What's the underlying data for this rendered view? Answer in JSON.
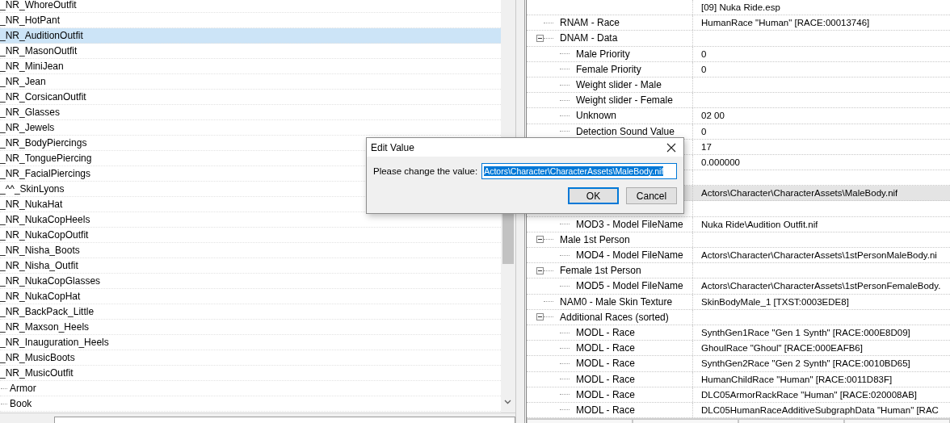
{
  "record_list": {
    "items": [
      {
        "label": "_NR_WhoreOutfit",
        "kind": "record",
        "selected": false
      },
      {
        "label": "_NR_HotPant",
        "kind": "record",
        "selected": false
      },
      {
        "label": "_NR_AuditionOutfit",
        "kind": "record",
        "selected": true
      },
      {
        "label": "_NR_MasonOutfit",
        "kind": "record",
        "selected": false
      },
      {
        "label": "_NR_MiniJean",
        "kind": "record",
        "selected": false
      },
      {
        "label": "_NR_Jean",
        "kind": "record",
        "selected": false
      },
      {
        "label": "_NR_CorsicanOutfit",
        "kind": "record",
        "selected": false
      },
      {
        "label": "_NR_Glasses",
        "kind": "record",
        "selected": false
      },
      {
        "label": "_NR_Jewels",
        "kind": "record",
        "selected": false
      },
      {
        "label": "_NR_BodyPiercings",
        "kind": "record",
        "selected": false
      },
      {
        "label": "_NR_TonguePiercing",
        "kind": "record",
        "selected": false
      },
      {
        "label": "_NR_FacialPiercings",
        "kind": "record",
        "selected": false
      },
      {
        "label": "_^^_SkinLyons",
        "kind": "record",
        "selected": false
      },
      {
        "label": "_NR_NukaHat",
        "kind": "record",
        "selected": false
      },
      {
        "label": "_NR_NukaCopHeels",
        "kind": "record",
        "selected": false
      },
      {
        "label": "_NR_NukaCopOutfit",
        "kind": "record",
        "selected": false
      },
      {
        "label": "_NR_Nisha_Boots",
        "kind": "record",
        "selected": false
      },
      {
        "label": "_NR_Nisha_Outfit",
        "kind": "record",
        "selected": false
      },
      {
        "label": "_NR_NukaCopGlasses",
        "kind": "record",
        "selected": false
      },
      {
        "label": "_NR_NukaCopHat",
        "kind": "record",
        "selected": false
      },
      {
        "label": "_NR_BackPack_Little",
        "kind": "record",
        "selected": false
      },
      {
        "label": "_NR_Maxson_Heels",
        "kind": "record",
        "selected": false
      },
      {
        "label": "_NR_Inauguration_Heels",
        "kind": "record",
        "selected": false
      },
      {
        "label": "_NR_MusicBoots",
        "kind": "record",
        "selected": false
      },
      {
        "label": "_NR_MusicOutfit",
        "kind": "record",
        "selected": false
      },
      {
        "label": "Armor",
        "kind": "group",
        "selected": false
      },
      {
        "label": "Book",
        "kind": "group",
        "selected": false
      }
    ]
  },
  "record_view": {
    "header": "[09] Nuka Ride.esp",
    "rows": [
      {
        "label": "RNAM - Race",
        "value": "HumanRace \"Human\" [RACE:00013746]",
        "selected": false
      },
      {
        "label": "DNAM - Data",
        "expanded": true,
        "selected": false,
        "children": [
          {
            "label": "Male Priority",
            "value": "0",
            "selected": false
          },
          {
            "label": "Female Priority",
            "value": "0",
            "selected": false
          },
          {
            "label": "Weight slider - Male",
            "selected": false
          },
          {
            "label": "Weight slider - Female",
            "selected": false
          },
          {
            "label": "Unknown",
            "value": "02 00",
            "selected": false
          },
          {
            "label": "Detection Sound Value",
            "value": "0",
            "selected": false
          },
          {
            "value": "17",
            "selected": false
          },
          {
            "value": "0.000000",
            "selected": false
          }
        ]
      },
      {
        "selected": false,
        "children": [
          {
            "value": "Actors\\Character\\CharacterAssets\\MaleBody.nif",
            "selected": true
          }
        ]
      },
      {
        "selected": false,
        "children": [
          {
            "label": "MOD3 - Model FileName",
            "value": "Nuka Ride\\Audition Outfit.nif",
            "selected": false
          }
        ]
      },
      {
        "label": "Male 1st Person",
        "expanded": true,
        "selected": false,
        "children": [
          {
            "label": "MOD4 - Model FileName",
            "value": "Actors\\Character\\CharacterAssets\\1stPersonMaleBody.ni",
            "selected": false
          }
        ]
      },
      {
        "label": "Female 1st Person",
        "expanded": true,
        "selected": false,
        "children": [
          {
            "label": "MOD5 - Model FileName",
            "value": "Actors\\Character\\CharacterAssets\\1stPersonFemaleBody.",
            "selected": false
          }
        ]
      },
      {
        "label": "NAM0 - Male Skin Texture",
        "value": "SkinBodyMale_1 [TXST:0003EDE8]",
        "selected": false
      },
      {
        "label": "Additional Races (sorted)",
        "expanded": true,
        "selected": false,
        "children": [
          {
            "label": "MODL - Race",
            "value": "SynthGen1Race \"Gen 1 Synth\" [RACE:000E8D09]",
            "selected": false
          },
          {
            "label": "MODL - Race",
            "value": "GhoulRace \"Ghoul\" [RACE:000EAFB6]",
            "selected": false
          },
          {
            "label": "MODL - Race",
            "value": "SynthGen2Race \"Gen 2 Synth\" [RACE:0010BD65]",
            "selected": false
          },
          {
            "label": "MODL - Race",
            "value": "HumanChildRace \"Human\" [RACE:0011D83F]",
            "selected": false
          },
          {
            "label": "MODL - Race",
            "value": "DLC05ArmorRackRace \"Human\" [RACE:020008AB]",
            "selected": false
          },
          {
            "label": "MODL - Race",
            "value": "DLC05HumanRaceAdditiveSubgraphData \"Human\" [RAC",
            "selected": false
          }
        ]
      }
    ]
  },
  "dialog": {
    "title": "Edit Value",
    "prompt": "Please change the value:",
    "field": {
      "value": "Actors\\Character\\CharacterAssets\\MaleBody.nif",
      "selected": true
    },
    "buttons": [
      {
        "label": "OK",
        "default": true
      },
      {
        "label": "Cancel",
        "default": false
      }
    ]
  }
}
